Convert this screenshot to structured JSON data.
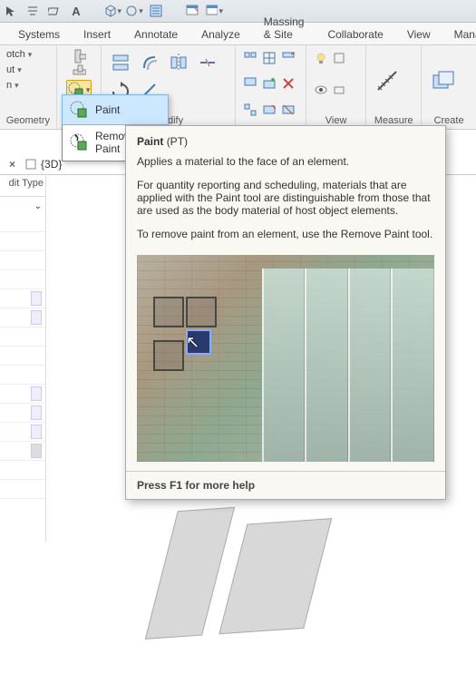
{
  "quick_access": {
    "items": [
      "cursor",
      "align",
      "plane",
      "text"
    ]
  },
  "tabs": [
    "Systems",
    "Insert",
    "Annotate",
    "Analyze",
    "Massing & Site",
    "Collaborate",
    "View",
    "Manage"
  ],
  "geometry_panel": {
    "label": "Geometry",
    "notch": "otch",
    "ut": "ut",
    "n": "n"
  },
  "modify_panel": {
    "label": "Modify"
  },
  "view_panel": {
    "label": "View"
  },
  "measure_panel": {
    "label": "Measure"
  },
  "create_panel": {
    "label": "Create"
  },
  "dropdown": {
    "items": [
      {
        "label": "Paint",
        "selected": true
      },
      {
        "label": "Remove Paint",
        "selected": false
      }
    ]
  },
  "tooltip": {
    "title": "Paint",
    "shortcut": "(PT)",
    "line1": "Applies a material to the face of an element.",
    "line2": "For quantity reporting and scheduling, materials that are applied with the Paint tool are distinguishable from those that are used as the body material of host object elements.",
    "line3": "To remove paint from an element, use the Remove Paint tool.",
    "footer": "Press F1 for more help"
  },
  "view_tab": {
    "name": "{3D}"
  },
  "properties": {
    "edit_type": "dit Type"
  }
}
